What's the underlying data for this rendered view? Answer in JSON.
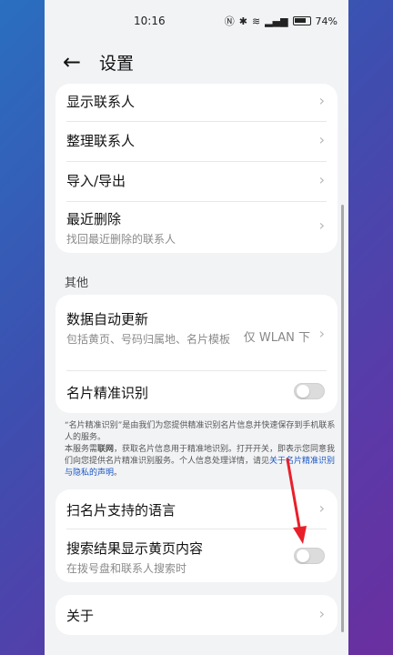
{
  "status": {
    "time": "10:16",
    "battery": "74%"
  },
  "header": {
    "back_icon": "back-arrow-icon",
    "title": "设置"
  },
  "card1": {
    "items": [
      {
        "label": "显示联系人"
      },
      {
        "label": "整理联系人"
      },
      {
        "label": "导入/导出"
      },
      {
        "label": "最近删除",
        "sub": "找回最近删除的联系人"
      }
    ]
  },
  "section_other": "其他",
  "card2": {
    "auto_update": {
      "label": "数据自动更新",
      "sub": "包括黄页、号码归属地、名片模板",
      "value": "仅 WLAN 下"
    },
    "card_recognition": {
      "label": "名片精准识别",
      "enabled": false
    }
  },
  "description": {
    "line1": "“名片精准识别”是由我们为您提供精准识别名片信息并快速保存到手机联系人的服务。",
    "line2_a": "本服务需",
    "line2_bold": "联网",
    "line2_b": "，获取名片信息用于精准地识别。打开开关，即表示您同意我们向您提供名片精准识别服务。个人信息处理详情，请见",
    "link": "关于名片精准识别与隐私的声明",
    "end": "。"
  },
  "card3": {
    "languages": {
      "label": "扫名片支持的语言"
    },
    "yellow_pages": {
      "label": "搜索结果显示黄页内容",
      "sub": "在拨号盘和联系人搜索时",
      "enabled": false
    }
  },
  "card4": {
    "about": {
      "label": "关于"
    }
  },
  "colors": {
    "accent_link": "#1a56c5",
    "arrow": "#e8202a"
  }
}
